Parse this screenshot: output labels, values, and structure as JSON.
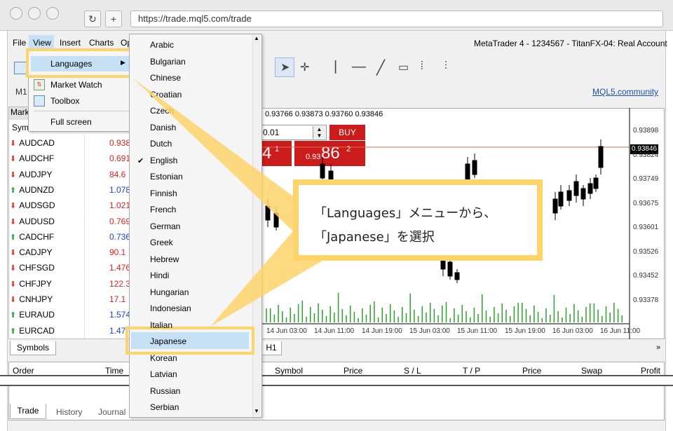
{
  "browser": {
    "url": "https://trade.mql5.com/trade",
    "refresh_icon": "refresh-icon",
    "plus_icon": "plus-icon"
  },
  "menu": {
    "file": "File",
    "view": "View",
    "insert": "Insert",
    "charts": "Charts",
    "op": "Op"
  },
  "window_title": "MetaTrader 4 - 1234567 - TitanFX-04: Real Account",
  "mql5_link": "MQL5.community",
  "timeframe": "M1",
  "view_menu": {
    "languages": "Languages",
    "market_watch": "Market Watch",
    "toolbox": "Toolbox",
    "full_screen": "Full screen"
  },
  "languages": [
    "Arabic",
    "Bulgarian",
    "Chinese",
    "Croatian",
    "Czech",
    "Danish",
    "Dutch",
    "English",
    "Estonian",
    "Finnish",
    "French",
    "German",
    "Greek",
    "Hebrew",
    "Hindi",
    "Hungarian",
    "Indonesian",
    "Italian",
    "Japanese",
    "Korean",
    "Latvian",
    "Russian",
    "Serbian"
  ],
  "selected_language": "English",
  "highlighted_language": "Japanese",
  "market_watch": {
    "header_market": "Mark",
    "header_symbol": "Sym",
    "tab": "Symbols",
    "rows": [
      {
        "symbol": "AUDCAD",
        "dir": "down",
        "value": "0.938"
      },
      {
        "symbol": "AUDCHF",
        "dir": "down",
        "value": "0.691"
      },
      {
        "symbol": "AUDJPY",
        "dir": "down",
        "value": "84.6"
      },
      {
        "symbol": "AUDNZD",
        "dir": "up",
        "value": "1.078"
      },
      {
        "symbol": "AUDSGD",
        "dir": "down",
        "value": "1.021"
      },
      {
        "symbol": "AUDUSD",
        "dir": "down",
        "value": "0.769"
      },
      {
        "symbol": "CADCHF",
        "dir": "up",
        "value": "0.736"
      },
      {
        "symbol": "CADJPY",
        "dir": "down",
        "value": "90.1"
      },
      {
        "symbol": "CHFSGD",
        "dir": "down",
        "value": "1.476"
      },
      {
        "symbol": "CHFJPY",
        "dir": "down",
        "value": "122.3"
      },
      {
        "symbol": "CNHJPY",
        "dir": "down",
        "value": "17.1"
      },
      {
        "symbol": "EURAUD",
        "dir": "up",
        "value": "1.574"
      },
      {
        "symbol": "EURCAD",
        "dir": "up",
        "value": "1.47"
      }
    ]
  },
  "chart": {
    "ohlc_header": "0.93766 0.93873 0.93760 0.93846",
    "volume_input": "0.01",
    "buy_label": "BUY",
    "sell_price_big": "4",
    "sell_price_sup": "1",
    "buy_price_small": "0.93",
    "buy_price_big": "86",
    "buy_price_sup": "2",
    "current_price": "0.93846",
    "price_axis": [
      "0.93898",
      "0.93824",
      "0.93749",
      "0.93675",
      "0.93601",
      "0.93526",
      "0.93452",
      "0.93378"
    ],
    "time_axis": [
      "14 Jun 03:00",
      "14 Jun 11:00",
      "14 Jun 19:00",
      "15 Jun 03:00",
      "15 Jun 11:00",
      "15 Jun 19:00",
      "16 Jun 03:00",
      "16 Jun 11:00"
    ],
    "tab_h1": "H1"
  },
  "terminal": {
    "columns": [
      "Order",
      "Time",
      "Symbol",
      "Price",
      "S / L",
      "T / P",
      "Price",
      "Swap",
      "Profit"
    ],
    "tabs": [
      "Trade",
      "History",
      "Journal"
    ]
  },
  "callout": {
    "line1": "「Languages」メニューから、",
    "line2": "「Japanese」を選択"
  },
  "colors": {
    "highlight": "#fdd46a",
    "sell_red": "#cc0000",
    "up_green": "#34a853",
    "down_red": "#e23c32"
  }
}
